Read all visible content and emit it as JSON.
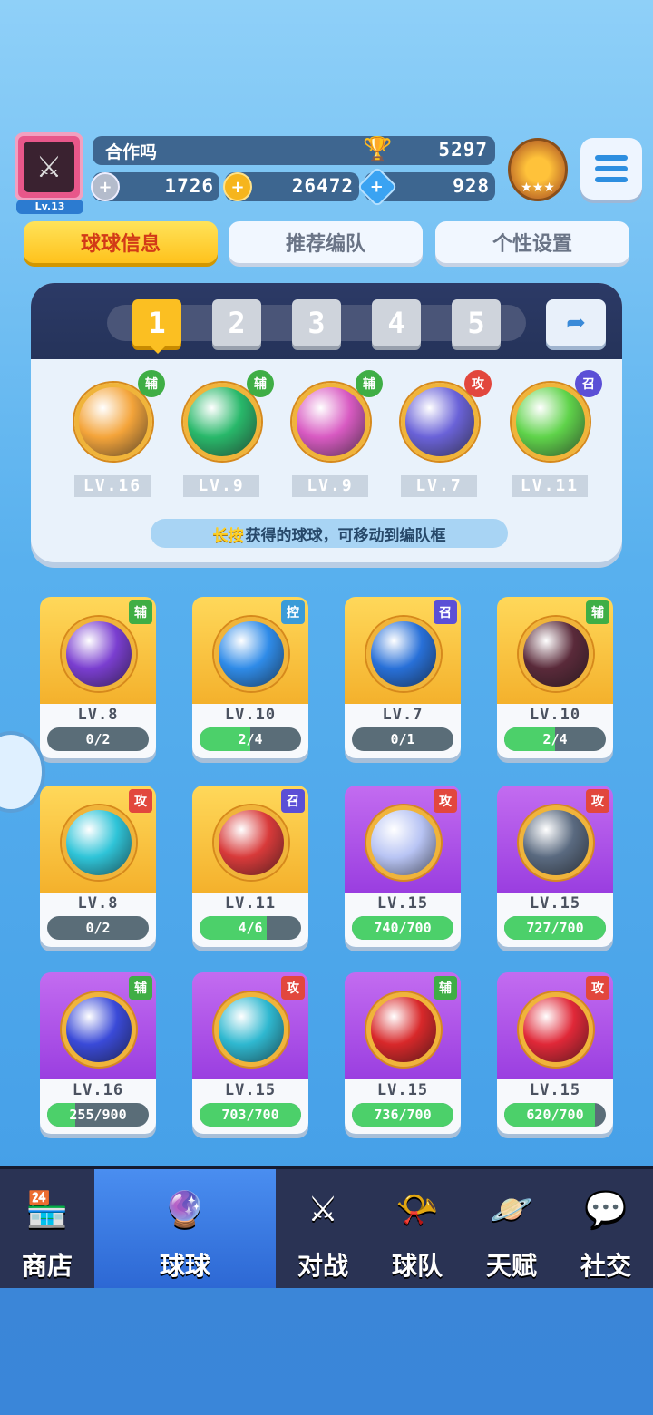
{
  "player": {
    "name": "合作吗",
    "level": "Lv.13",
    "trophy": "5297",
    "silver": "1726",
    "gold": "26472",
    "gem": "928"
  },
  "tabs": [
    "球球信息",
    "推荐编队",
    "个性设置"
  ],
  "team": {
    "slots": [
      "1",
      "2",
      "3",
      "4",
      "5"
    ],
    "active_slot": "1",
    "balls": [
      {
        "tag": "辅",
        "level": "LV.16",
        "color": "#f4a43a"
      },
      {
        "tag": "辅",
        "level": "LV.9",
        "color": "#28b86a"
      },
      {
        "tag": "辅",
        "level": "LV.9",
        "color": "#d85ac2"
      },
      {
        "tag": "攻",
        "level": "LV.7",
        "color": "#6a62d8"
      },
      {
        "tag": "召",
        "level": "LV.11",
        "color": "#5fd34a"
      }
    ],
    "hint_highlight": "长按",
    "hint_text": "获得的球球，可移动到编队框"
  },
  "collection": [
    {
      "tag": "辅",
      "level": "LV.8",
      "progress": "0/2",
      "fill": 0,
      "bg": "gold",
      "orb": "#7a3ed0"
    },
    {
      "tag": "控",
      "level": "LV.10",
      "progress": "2/4",
      "fill": 0.5,
      "bg": "gold",
      "orb": "#2f8be8"
    },
    {
      "tag": "召",
      "level": "LV.7",
      "progress": "0/1",
      "fill": 0,
      "bg": "gold",
      "orb": "#2870d8"
    },
    {
      "tag": "辅",
      "level": "LV.10",
      "progress": "2/4",
      "fill": 0.5,
      "bg": "gold",
      "orb": "#5a2a3a"
    },
    {
      "tag": "攻",
      "level": "LV.8",
      "progress": "0/2",
      "fill": 0,
      "bg": "gold",
      "orb": "#2fc4d8"
    },
    {
      "tag": "召",
      "level": "LV.11",
      "progress": "4/6",
      "fill": 0.66,
      "bg": "gold",
      "orb": "#d83a3a"
    },
    {
      "tag": "攻",
      "level": "LV.15",
      "progress": "740/700",
      "fill": 1,
      "bg": "purple",
      "orb": "#b8c4f4"
    },
    {
      "tag": "攻",
      "level": "LV.15",
      "progress": "727/700",
      "fill": 1,
      "bg": "purple",
      "orb": "#5a6a80"
    },
    {
      "tag": "辅",
      "level": "LV.16",
      "progress": "255/900",
      "fill": 0.28,
      "bg": "purple",
      "orb": "#3a4ad8"
    },
    {
      "tag": "攻",
      "level": "LV.15",
      "progress": "703/700",
      "fill": 1,
      "bg": "purple",
      "orb": "#2fb8d0"
    },
    {
      "tag": "辅",
      "level": "LV.15",
      "progress": "736/700",
      "fill": 1,
      "bg": "purple",
      "orb": "#d8282a"
    },
    {
      "tag": "攻",
      "level": "LV.15",
      "progress": "620/700",
      "fill": 0.89,
      "bg": "purple",
      "orb": "#e02838"
    }
  ],
  "nav": [
    {
      "label": "商店",
      "icon": "shop-icon",
      "glyph": "🏪"
    },
    {
      "label": "球球",
      "icon": "ball-icon",
      "glyph": "🔮"
    },
    {
      "label": "对战",
      "icon": "crossed-swords-icon",
      "glyph": "⚔"
    },
    {
      "label": "球队",
      "icon": "whistle-icon",
      "glyph": "📯"
    },
    {
      "label": "天赋",
      "icon": "planet-icon",
      "glyph": "🪐"
    },
    {
      "label": "社交",
      "icon": "chat-heart-icon",
      "glyph": "💬"
    }
  ],
  "nav_active": "球球"
}
